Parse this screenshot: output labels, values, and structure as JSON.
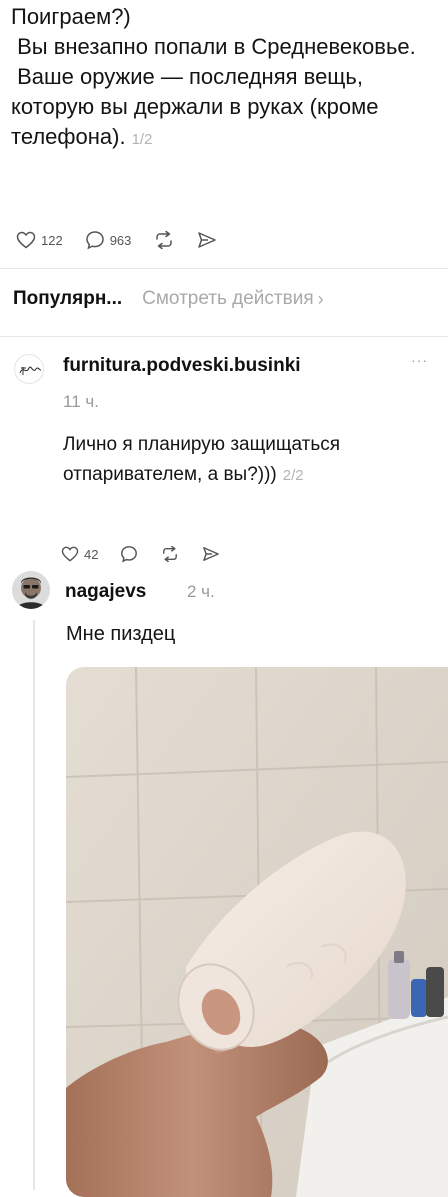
{
  "post": {
    "text": "Поиграем?)\n Вы внезапно попали в Средневековье.\n Ваше оружие — последняя вещь, которую вы держали в руках (кроме телефона).",
    "page_indicator": "1/2",
    "likes": "122",
    "comments": "963"
  },
  "sort": {
    "popular": "Популярн...",
    "activity": "Смотреть действия",
    "chevron": "›"
  },
  "comment1": {
    "avatar_text": "Furnitura",
    "username": "furnitura.podveski.businki",
    "time": "11 ч.",
    "text": "Лично я планирую защищаться отпаривателем, а вы?)))",
    "page_indicator": "2/2",
    "likes": "42",
    "more": "···"
  },
  "comment2": {
    "username": "nagajevs",
    "time": "2 ч.",
    "text": "Мне пиздец"
  },
  "icons": [
    "heart-icon",
    "comment-icon",
    "repost-icon",
    "share-icon"
  ]
}
